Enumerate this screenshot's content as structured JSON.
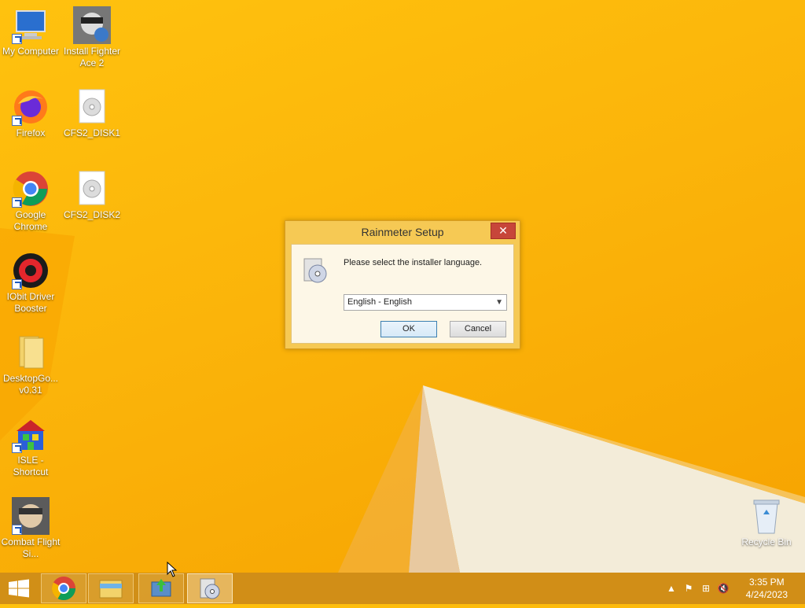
{
  "desktop": {
    "icons": [
      {
        "label": "My Computer",
        "icon": "computer-icon"
      },
      {
        "label": "Install Fighter Ace 2",
        "icon": "fighter-ace-installer-icon"
      },
      {
        "label": "Firefox",
        "icon": "firefox-icon"
      },
      {
        "label": "CFS2_DISK1",
        "icon": "disc-image-icon"
      },
      {
        "label": "Google Chrome",
        "icon": "chrome-icon"
      },
      {
        "label": "CFS2_DISK2",
        "icon": "disc-image-icon"
      },
      {
        "label": "IObit Driver Booster",
        "icon": "driver-booster-icon"
      },
      {
        "label": "DesktopGo... v0.31",
        "icon": "folder-icon"
      },
      {
        "label": "ISLE - Shortcut",
        "icon": "isle-icon"
      },
      {
        "label": "Combat Flight Si...",
        "icon": "combat-flight-sim-icon"
      },
      {
        "label": "Recycle Bin",
        "icon": "recycle-bin-icon"
      }
    ]
  },
  "dialog": {
    "title": "Rainmeter Setup",
    "close_label": "✕",
    "prompt": "Please select the installer language.",
    "language_selected": "English - English",
    "ok_label": "OK",
    "cancel_label": "Cancel"
  },
  "taskbar": {
    "buttons": [
      "start-button",
      "chrome-taskbar-button",
      "file-explorer-taskbar-button",
      "installer-taskbar-button",
      "rainmeter-setup-taskbar-button"
    ],
    "clock_time": "3:35 PM",
    "clock_date": "4/24/2023"
  },
  "colors": {
    "wallpaper": "#fbb40a",
    "taskbar": "#cd8c19",
    "dialog_frame": "#f6c954",
    "close_button": "#c7463a"
  }
}
